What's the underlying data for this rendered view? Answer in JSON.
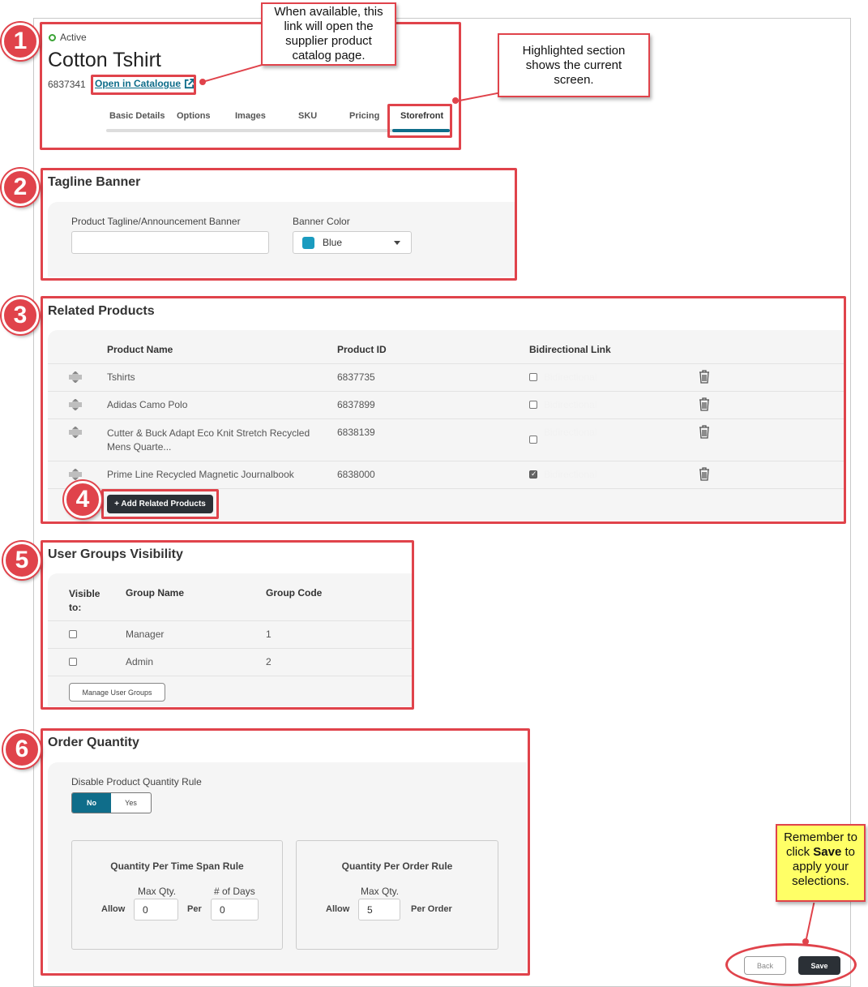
{
  "header": {
    "status": "Active",
    "title": "Cotton Tshirt",
    "product_id": "6837341",
    "catalogue_link": "Open in Catalogue",
    "tabs": [
      "Basic Details",
      "Options",
      "Images",
      "SKU",
      "Pricing",
      "Storefront"
    ],
    "active_tab": "Storefront"
  },
  "callouts": {
    "catalogue": "When available, this link will open the supplier product catalog page.",
    "highlight": "Highlighted section shows the current screen.",
    "save_before": "Remember to click ",
    "save_bold": "Save",
    "save_after": " to apply your selections."
  },
  "badges": [
    "1",
    "2",
    "3",
    "4",
    "5",
    "6"
  ],
  "tagline": {
    "title": "Tagline Banner",
    "banner_label": "Product Tagline/Announcement Banner",
    "banner_value": "",
    "color_label": "Banner Color",
    "color_value": "Blue",
    "color_hex": "#1a9bbf"
  },
  "related": {
    "title": "Related Products",
    "columns": [
      "Product Name",
      "Product ID",
      "Bidirectional Link"
    ],
    "rows": [
      {
        "name": "Tshirts",
        "id": "6837735",
        "checked": false,
        "link_label": "Bidirectional"
      },
      {
        "name": "Adidas Camo Polo",
        "id": "6837899",
        "checked": false,
        "link_label": "Bidirectional"
      },
      {
        "name": "Cutter & Buck Adapt Eco Knit Stretch Recycled Mens Quarte...",
        "id": "6838139",
        "checked": false,
        "link_label": "Bidirectional"
      },
      {
        "name": "Prime Line Recycled Magnetic Journalbook",
        "id": "6838000",
        "checked": true,
        "link_label": "Bidirectional"
      }
    ],
    "add_button": "+ Add Related Products"
  },
  "user_groups": {
    "title": "User Groups Visibility",
    "columns": [
      "Visible to:",
      "Group Name",
      "Group Code"
    ],
    "rows": [
      {
        "name": "Manager",
        "code": "1"
      },
      {
        "name": "Admin",
        "code": "2"
      }
    ],
    "manage_button": "Manage User Groups"
  },
  "order_quantity": {
    "title": "Order Quantity",
    "disable_label": "Disable Product Quantity Rule",
    "toggle_no": "No",
    "toggle_yes": "Yes",
    "toggle_value": "No",
    "time_span": {
      "title": "Quantity Per Time Span Rule",
      "max_label": "Max Qty.",
      "days_label": "# of Days",
      "allow": "Allow",
      "per": "Per",
      "max_value": "0",
      "days_value": "0"
    },
    "per_order": {
      "title": "Quantity Per Order Rule",
      "max_label": "Max Qty.",
      "allow": "Allow",
      "per_order": "Per Order",
      "max_value": "5"
    }
  },
  "footer": {
    "back": "Back",
    "save": "Save"
  },
  "colors": {
    "accent": "#0f6d8a",
    "annotation_red": "#e0434b",
    "dark_button": "#2b3036",
    "status_green": "#3aa335"
  }
}
